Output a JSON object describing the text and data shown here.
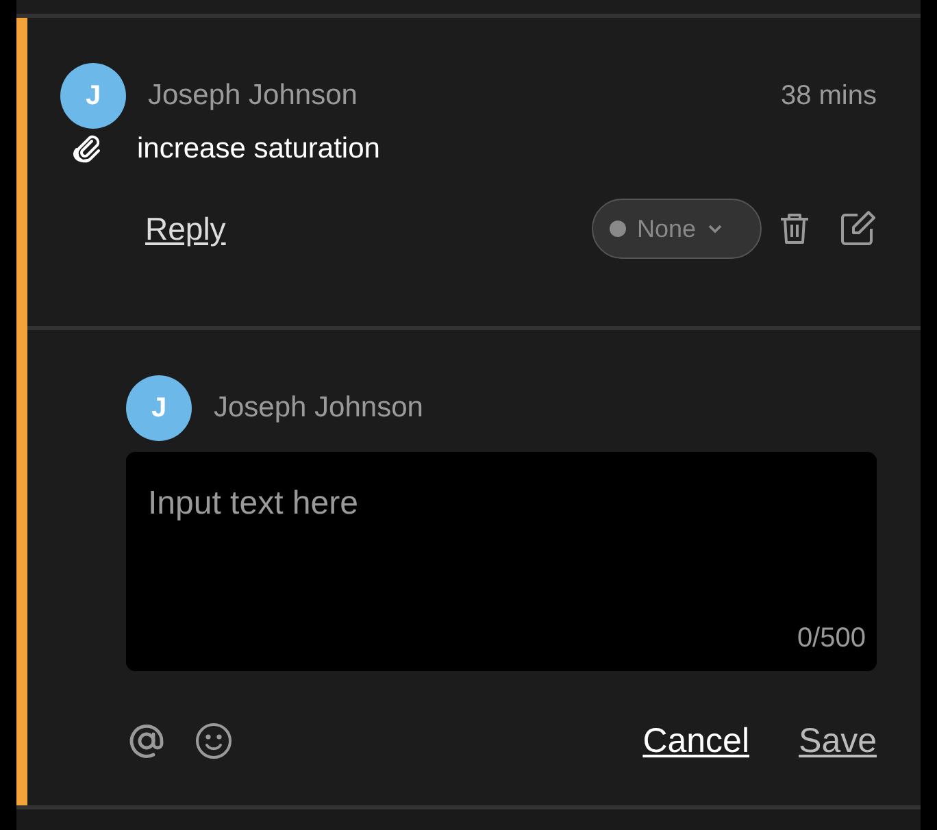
{
  "comment": {
    "avatar_initial": "J",
    "author": "Joseph Johnson",
    "time": "38 mins",
    "text": "increase saturation",
    "reply_label": "Reply",
    "status": "None"
  },
  "reply_editor": {
    "avatar_initial": "J",
    "author": "Joseph Johnson",
    "placeholder": "Input text here",
    "counter": "0/500",
    "cancel_label": "Cancel",
    "save_label": "Save",
    "save_disabled": true
  }
}
